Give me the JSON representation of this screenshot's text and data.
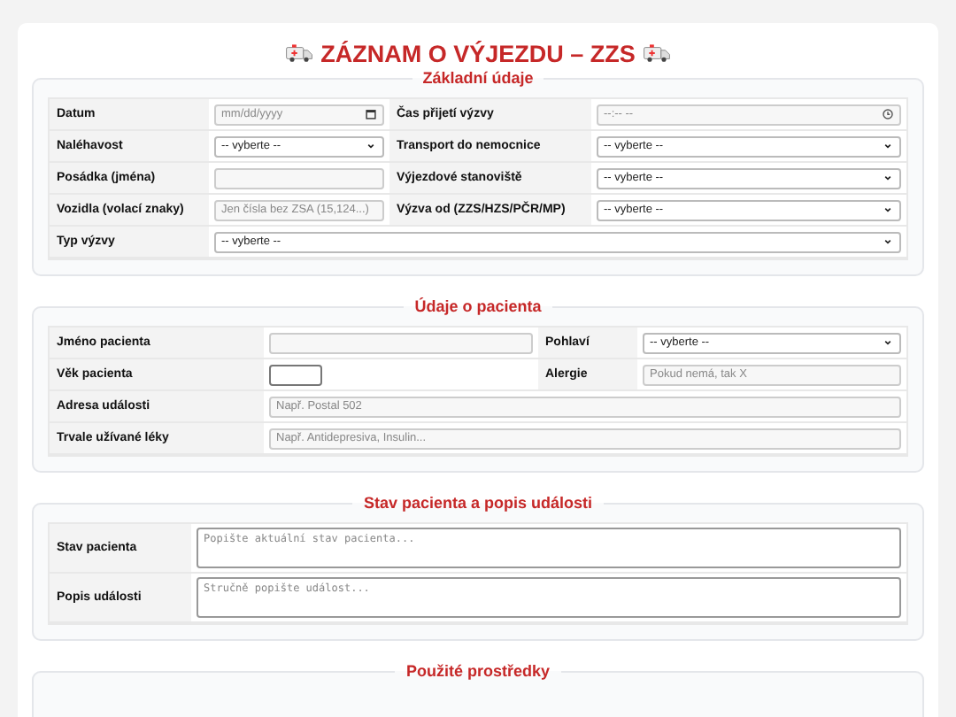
{
  "title": "ZÁZNAM O VÝJEZDU – ZZS",
  "sections": [
    {
      "legend": "Základní údaje",
      "kind": "four",
      "rows": [
        [
          {
            "label": "Datum",
            "field": {
              "kind": "date",
              "placeholder": "mm/dd/yyyy"
            }
          },
          {
            "label": "Čas přijetí výzvy",
            "field": {
              "kind": "time",
              "placeholder": "--:-- --"
            }
          }
        ],
        [
          {
            "label": "Naléhavost",
            "field": {
              "kind": "select",
              "value": "-- vyberte --"
            }
          },
          {
            "label": "Transport do nemocnice",
            "field": {
              "kind": "select",
              "value": "-- vyberte --"
            }
          }
        ],
        [
          {
            "label": "Posádka (jména)",
            "field": {
              "kind": "text"
            }
          },
          {
            "label": "Výjezdové stanoviště",
            "field": {
              "kind": "select",
              "value": "-- vyberte --"
            }
          }
        ],
        [
          {
            "label": "Vozidla (volací znaky)",
            "field": {
              "kind": "text",
              "placeholder": "Jen čísla bez ZSA (15,124...)"
            }
          },
          {
            "label": "Výzva od (ZZS/HZS/PČR/MP)",
            "field": {
              "kind": "select",
              "value": "-- vyberte --"
            }
          }
        ],
        [
          {
            "label": "Typ výzvy",
            "field": {
              "kind": "select",
              "value": "-- vyberte --"
            }
          }
        ]
      ]
    },
    {
      "legend": "Údaje o pacienta",
      "kind": "patient",
      "rows": [
        [
          {
            "label": "Jméno pacienta",
            "field": {
              "kind": "text"
            }
          },
          {
            "label": "Pohlaví",
            "field": {
              "kind": "select",
              "value": "-- vyberte --"
            }
          }
        ],
        [
          {
            "label": "Věk pacienta",
            "field": {
              "kind": "number"
            }
          },
          {
            "label": "Alergie",
            "field": {
              "kind": "text",
              "placeholder": "Pokud nemá, tak X"
            }
          }
        ],
        [
          {
            "label": "Adresa události",
            "field": {
              "kind": "text",
              "placeholder": "Např. Postal 502"
            }
          }
        ],
        [
          {
            "label": "Trvale užívané léky",
            "field": {
              "kind": "text",
              "placeholder": "Např. Antidepresiva, Insulin..."
            }
          }
        ]
      ]
    },
    {
      "legend": "Stav pacienta a popis události",
      "kind": "wide",
      "rows": [
        [
          {
            "label": "Stav pacienta",
            "field": {
              "kind": "textarea",
              "placeholder": "Popište aktuální stav pacienta..."
            }
          }
        ],
        [
          {
            "label": "Popis události",
            "field": {
              "kind": "textarea",
              "placeholder": "Stručně popište událost..."
            }
          }
        ]
      ]
    },
    {
      "legend": "Použité prostředky",
      "kind": "list"
    }
  ]
}
